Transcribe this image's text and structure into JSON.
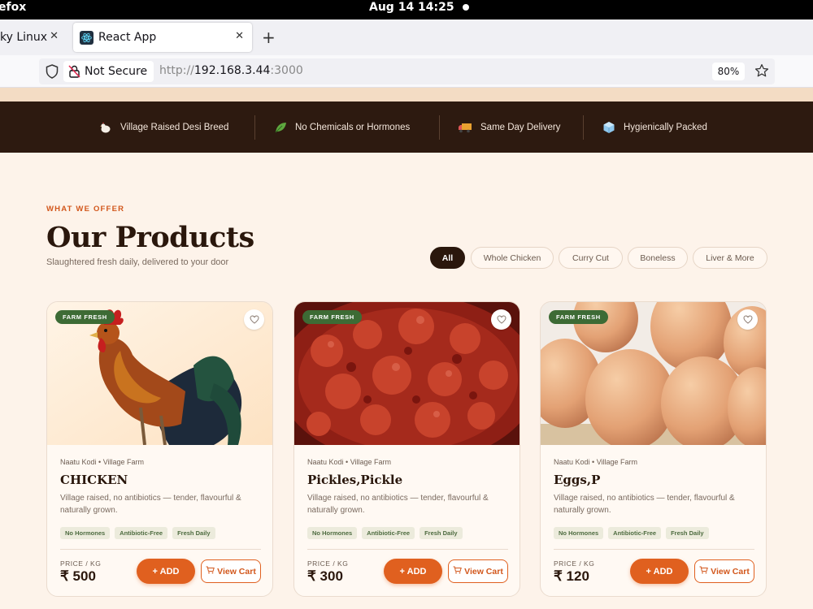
{
  "system": {
    "app_name": "efox",
    "clock": "Aug 14  14:25"
  },
  "browser": {
    "tabs": [
      {
        "label": "ky Linux",
        "active": false
      },
      {
        "label": "React App",
        "active": true
      }
    ],
    "security_label": "Not Secure",
    "url_protocol": "http://",
    "url_host": "192.168.3.44",
    "url_port": ":3000",
    "zoom": "80%"
  },
  "trust_bar": [
    {
      "icon": "chicken-icon",
      "label": "Village Raised Desi Breed"
    },
    {
      "icon": "leaf-icon",
      "label": "No Chemicals or Hormones"
    },
    {
      "icon": "truck-icon",
      "label": "Same Day Delivery"
    },
    {
      "icon": "ice-cube-icon",
      "label": "Hygienically Packed"
    }
  ],
  "section": {
    "kicker": "WHAT WE OFFER",
    "title": "Our Products",
    "subtitle": "Slaughtered fresh daily, delivered to your door"
  },
  "filters": [
    {
      "label": "All",
      "active": true
    },
    {
      "label": "Whole Chicken",
      "active": false
    },
    {
      "label": "Curry Cut",
      "active": false
    },
    {
      "label": "Boneless",
      "active": false
    },
    {
      "label": "Liver & More",
      "active": false
    }
  ],
  "products": [
    {
      "badge": "FARM FRESH",
      "breed": "Naatu Kodi",
      "farm": "Village Farm",
      "name": "CHICKEN",
      "description": "Village raised, no antibiotics — tender, flavourful & naturally grown.",
      "tags": [
        "No Hormones",
        "Antibiotic-Free",
        "Fresh Daily"
      ],
      "price_label": "PRICE / KG",
      "price": "₹ 500",
      "add_label": "+ ADD",
      "view_label": "View Cart",
      "image": "rooster-photo"
    },
    {
      "badge": "FARM FRESH",
      "breed": "Naatu Kodi",
      "farm": "Village Farm",
      "name": "Pickles,Pickle",
      "description": "Village raised, no antibiotics — tender, flavourful & naturally grown.",
      "tags": [
        "No Hormones",
        "Antibiotic-Free",
        "Fresh Daily"
      ],
      "price_label": "PRICE / KG",
      "price": "₹ 300",
      "add_label": "+ ADD",
      "view_label": "View Cart",
      "image": "pickle-photo"
    },
    {
      "badge": "FARM FRESH",
      "breed": "Naatu Kodi",
      "farm": "Village Farm",
      "name": "Eggs,P",
      "description": "Village raised, no antibiotics — tender, flavourful & naturally grown.",
      "tags": [
        "No Hormones",
        "Antibiotic-Free",
        "Fresh Daily"
      ],
      "price_label": "PRICE / KG",
      "price": "₹ 120",
      "add_label": "+ ADD",
      "view_label": "View Cart",
      "image": "eggs-photo"
    }
  ],
  "colors": {
    "accent": "#e0601f",
    "dark": "#2a170c",
    "badge_green": "#3d6b35",
    "page_bg": "#fdf3ea"
  }
}
